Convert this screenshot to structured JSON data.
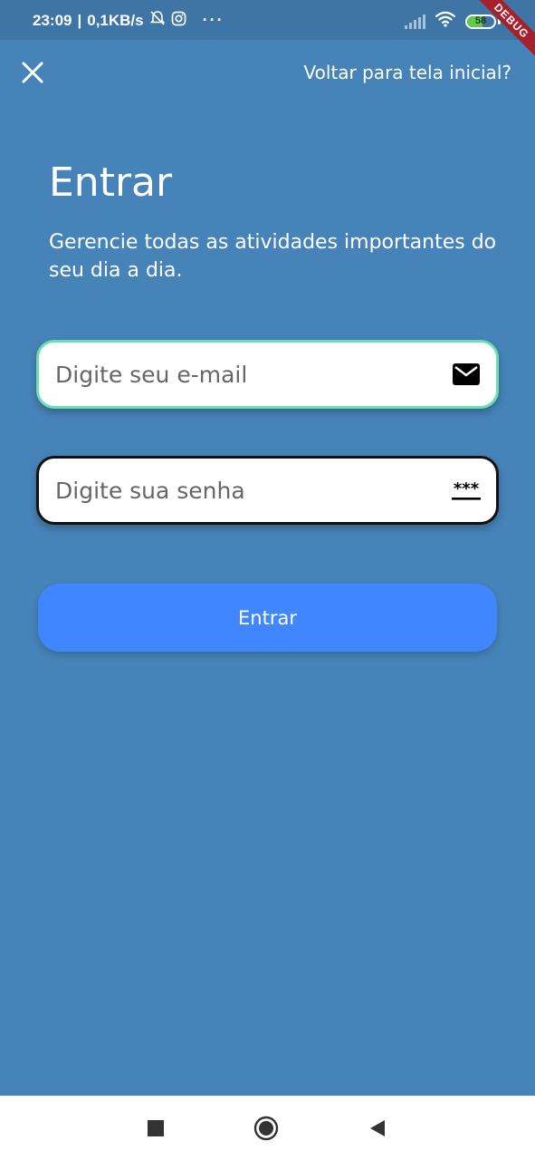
{
  "status_bar": {
    "time": "23:09",
    "network_speed": "0,1KB/s",
    "battery_level": "58",
    "icons": [
      "muted-alarm-icon",
      "instagram-icon",
      "more-dots-icon",
      "signal-icon",
      "wifi-icon",
      "battery-icon"
    ],
    "debug_banner": "DEBUG"
  },
  "top_bar": {
    "close_icon": "close-icon",
    "back_link": "Voltar para tela inicial?"
  },
  "header": {
    "title": "Entrar",
    "subtitle": "Gerencie todas as atividades importantes do seu dia a dia."
  },
  "form": {
    "email": {
      "placeholder": "Digite seu e-mail",
      "value": "",
      "icon": "mail-icon",
      "border_color": "#6ddeb0"
    },
    "password": {
      "placeholder": "Digite sua senha",
      "value": "",
      "icon": "password-icon",
      "border_color": "#111111"
    },
    "submit_label": "Entrar"
  },
  "nav_bar": {
    "buttons": [
      "recent-apps-button",
      "home-button",
      "back-button"
    ]
  },
  "colors": {
    "background": "#4683b8",
    "status_bar": "#3e75a5",
    "primary_button": "#3f86ff",
    "debug_ribbon": "#a5212b",
    "battery_fill": "#62c94a"
  }
}
